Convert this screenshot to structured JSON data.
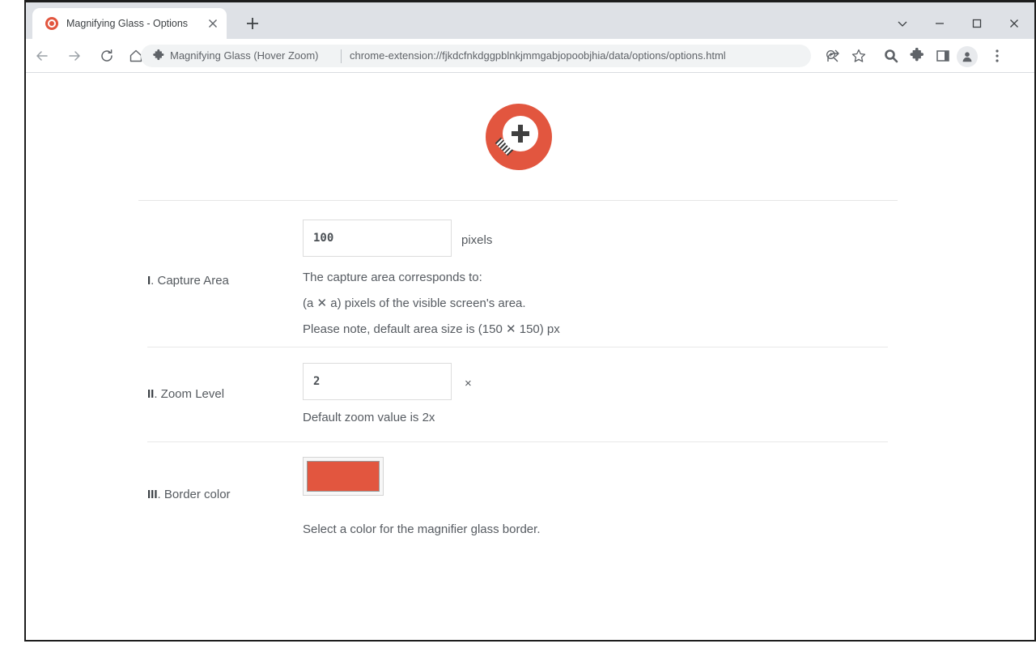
{
  "browser": {
    "tab": {
      "title": "Magnifying Glass - Options",
      "favicon": "magnifier-favicon",
      "close_label": "✕",
      "new_tab_label": "+"
    },
    "window_controls": {
      "tab_search": "tab-search-chevron",
      "minimize": "minimize",
      "maximize": "maximize",
      "close": "close"
    },
    "nav": {
      "back": "back-arrow",
      "forward": "forward-arrow",
      "reload": "reload",
      "home": "home"
    },
    "omnibox": {
      "extension_icon": "puzzle-piece-icon",
      "extension_name": "Magnifying Glass (Hover Zoom)",
      "url": "chrome-extension://fjkdcfnkdggpblnkjmmgabjopoobjhia/data/options/options.html",
      "zoom_icon": "zoom-in-icon"
    },
    "actions": {
      "share": "share-icon",
      "bookmark": "star-icon",
      "extension_magnifier": "magnifier-icon",
      "extensions": "puzzle-piece-icon",
      "side_panel": "side-panel-icon",
      "profile": "profile-avatar-icon",
      "menu": "three-dot-menu-icon"
    }
  },
  "page": {
    "logo": "magnifying-glass-logo",
    "sections": [
      {
        "numeral": "I",
        "label": ". Capture Area",
        "value": "100",
        "unit": "pixels",
        "descriptions": [
          "The capture area corresponds to:",
          "(a ✕ a) pixels of the visible screen's area.",
          "Please note, default area size is (150 ✕ 150) px"
        ]
      },
      {
        "numeral": "II",
        "label": ". Zoom Level",
        "value": "2",
        "unit": "×",
        "descriptions": [
          "Default zoom value is 2x"
        ]
      },
      {
        "numeral": "III",
        "label": ". Border color",
        "value": "#e2563f",
        "descriptions": [
          "Select a color for the magnifier glass border."
        ]
      }
    ]
  },
  "colors": {
    "brand": "#e2563f",
    "border_color_value": "#e2563f",
    "text": "#565b61",
    "tabstrip": "#dee1e6"
  }
}
